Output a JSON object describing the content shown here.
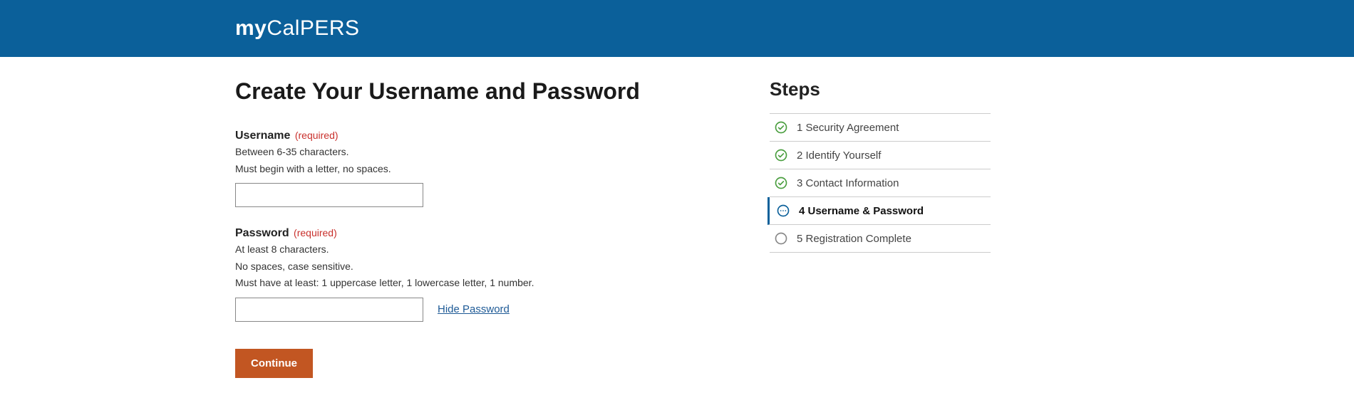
{
  "logo": {
    "prefix": "my",
    "rest": "CalPERS"
  },
  "page": {
    "title": "Create Your Username and Password",
    "username": {
      "label": "Username",
      "required": "(required)",
      "hint1": "Between 6-35 characters.",
      "hint2": "Must begin with a letter, no spaces.",
      "value": ""
    },
    "password": {
      "label": "Password",
      "required": "(required)",
      "hint1": "At least 8 characters.",
      "hint2": "No spaces, case sensitive.",
      "hint3": "Must have at least: 1 uppercase letter, 1 lowercase letter, 1 number.",
      "value": "",
      "toggle": "Hide Password"
    },
    "continue": "Continue"
  },
  "steps": {
    "title": "Steps",
    "items": [
      {
        "label": "1 Security Agreement",
        "state": "done"
      },
      {
        "label": "2 Identify Yourself",
        "state": "done"
      },
      {
        "label": "3 Contact Information",
        "state": "done"
      },
      {
        "label": "4 Username & Password",
        "state": "current"
      },
      {
        "label": "5 Registration Complete",
        "state": "pending"
      }
    ]
  }
}
